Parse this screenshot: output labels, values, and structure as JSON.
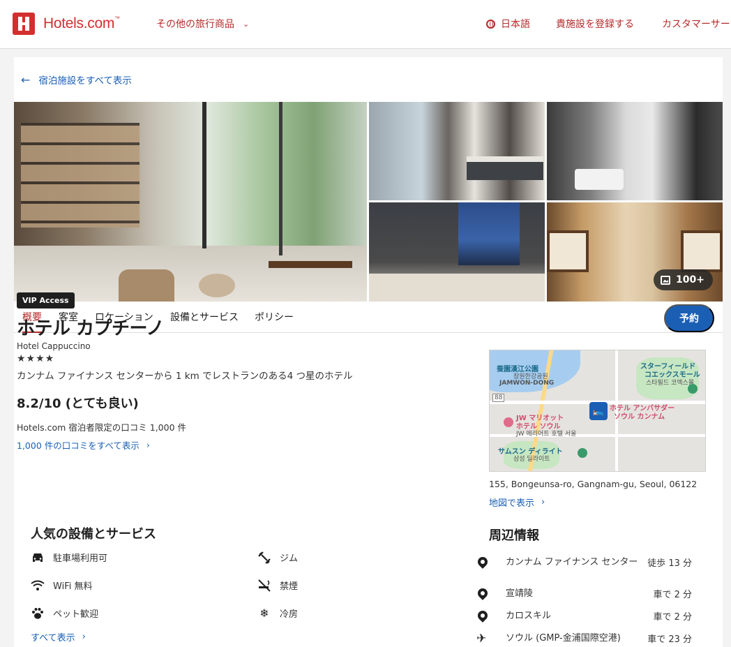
{
  "header": {
    "logo_text": "Hotels.com",
    "logo_tm": "™",
    "more_travel": "その他の旅行商品",
    "language": "日本語",
    "register": "貴施設を登録する",
    "support": "カスタマーサー"
  },
  "back_link": "宿泊施設をすべて表示",
  "gallery": {
    "more_photos": "100+"
  },
  "tabs": [
    "概要",
    "客室",
    "ロケーション",
    "設備とサービス",
    "ポリシー"
  ],
  "active_tab": "概要",
  "reserve_button": "予約",
  "hotel": {
    "badge": "VIP Access",
    "name": "ホテル カプチーノ",
    "name_en": "Hotel Cappuccino",
    "stars": "★★★★",
    "description": "カンナム ファイナンス センターから 1 km でレストランのある4 つ星のホテル",
    "rating": "8.2/10 (とても良い)",
    "review_source": "Hotels.com 宿泊者限定の口コミ 1,000 件",
    "review_link": "1,000 件の口コミをすべて表示"
  },
  "amenities": {
    "title": "人気の設備とサービス",
    "items": [
      {
        "label": "駐車場利用可",
        "icon": "car-icon"
      },
      {
        "label": "ジム",
        "icon": "dumbbell-icon"
      },
      {
        "label": "WiFi 無料",
        "icon": "wifi-icon"
      },
      {
        "label": "禁煙",
        "icon": "no-smoking-icon"
      },
      {
        "label": "ペット歓迎",
        "icon": "paw-icon"
      },
      {
        "label": "冷房",
        "icon": "snowflake-icon"
      }
    ],
    "see_all": "すべて表示"
  },
  "map": {
    "labels": {
      "park": "蚕園漢江公園",
      "park_ko": "잠원한강공원",
      "jamwon": "JAMWON-DONG",
      "starfield": "スターフィールド",
      "coex": "コエックスモール",
      "coex_ko": "스타필드 코엑스몰",
      "jw": "JW マリオット",
      "jw2": "ホテル ソウル",
      "jw_ko": "JW 메리어트 호텔 서울",
      "ambassador": "ホテル アンバサダー",
      "ambassador2": "ソウル カンナム",
      "samsung": "サムスン ディライト",
      "samsung_ko": "삼성 딜라이트",
      "route": "88"
    },
    "address": "155, Bongeunsa-ro, Gangnam-gu, Seoul, 06122",
    "link": "地図で表示"
  },
  "nearby": {
    "title": "周辺情報",
    "items": [
      {
        "name": "カンナム ファイナンス センター",
        "time": "徒歩 13 分",
        "icon": "pin-icon"
      },
      {
        "name": "宣靖陵",
        "time": "車で 2 分",
        "icon": "pin-icon"
      },
      {
        "name": "カロスキル",
        "time": "車で 2 分",
        "icon": "pin-icon"
      },
      {
        "name": "ソウル (GMP-金浦国際空港)",
        "time": "車で 23 分",
        "icon": "plane-icon"
      }
    ]
  },
  "colors": {
    "brand_red": "#d32f2f",
    "link_blue": "#1a5fb4",
    "reserve_blue": "#1a5fb4"
  }
}
